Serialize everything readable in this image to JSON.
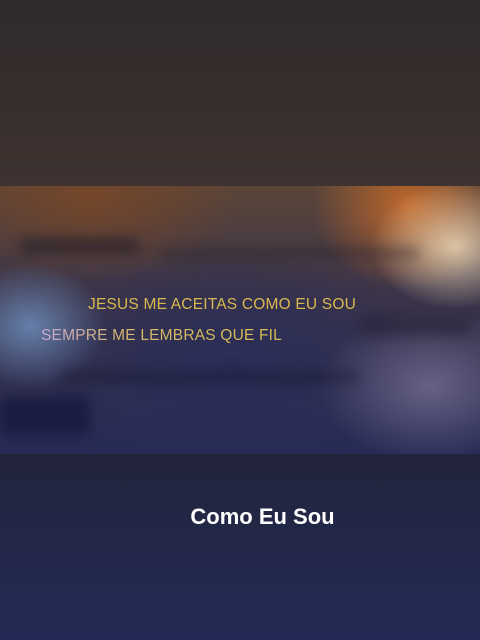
{
  "video": {
    "lyrics": [
      "JESUS ME ACEITAS COMO EU SOU",
      "SEMPRE ME LEMBRAS QUE FIL"
    ],
    "lyric_color": "#d9b94e"
  },
  "caption": {
    "title": "Como Eu Sou",
    "color": "#ffffff"
  }
}
